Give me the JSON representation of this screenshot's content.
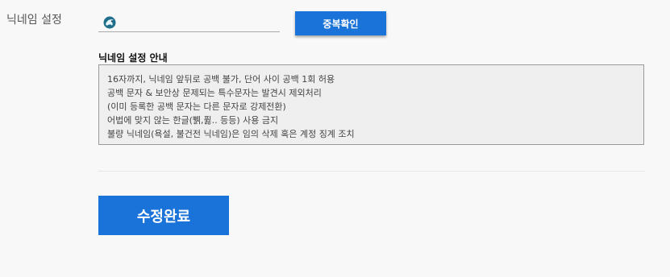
{
  "nickname": {
    "label": "닉네임 설정",
    "input_value": "",
    "icon": "dolphin-icon",
    "check_button_label": "중복확인"
  },
  "guide": {
    "title": "닉네임 설정 안내",
    "lines": [
      "16자까지, 닉네임 앞뒤로 공백 불가, 단어 사이 공백 1회 허용",
      "공백 문자 & 보안상 문제되는 특수문자는 발견시 제외처리",
      "(이미 등록한 공백 문자는 다른 문자로 강제전환)",
      "어법에 맞지 않는 한글(쀍,퓛.. 등등) 사용 금지",
      "불량 닉네임(욕설, 불건전 닉네임)은 임의 삭제 혹은 계정 징계 조치"
    ]
  },
  "submit_button_label": "수정완료",
  "colors": {
    "accent": "#1a73d9",
    "guide_background": "#efefef",
    "page_background": "#f8f8f8"
  }
}
